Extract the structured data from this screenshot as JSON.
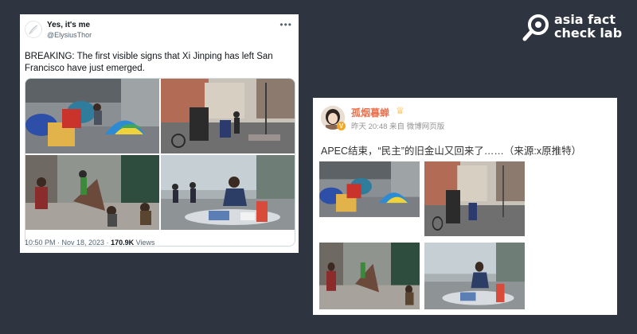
{
  "brand": {
    "line1": "asia fact",
    "line2": "check lab"
  },
  "tweet": {
    "name": "Yes, it's me",
    "handle": "@ElysiusThor",
    "more_icon": "more-icon",
    "text": "BREAKING: The first visible signs that Xi Jinping has left San Francisco have just emerged.",
    "time": "10:50 PM · Nov 18, 2023 · ",
    "views_count": "170.9K",
    "views_label": " Views"
  },
  "weibo": {
    "name": "孤烟暮蝉",
    "meta": "昨天 20:48 来自 微博网页版",
    "text": "APEC结束，“民主”的旧金山又回来了……（来源:x原推特）",
    "verified_badge": "V"
  },
  "photos": [
    {
      "name": "photo-tents-street"
    },
    {
      "name": "photo-street-trash"
    },
    {
      "name": "photo-sidewalk-people"
    },
    {
      "name": "photo-sidewalk-debris"
    }
  ]
}
